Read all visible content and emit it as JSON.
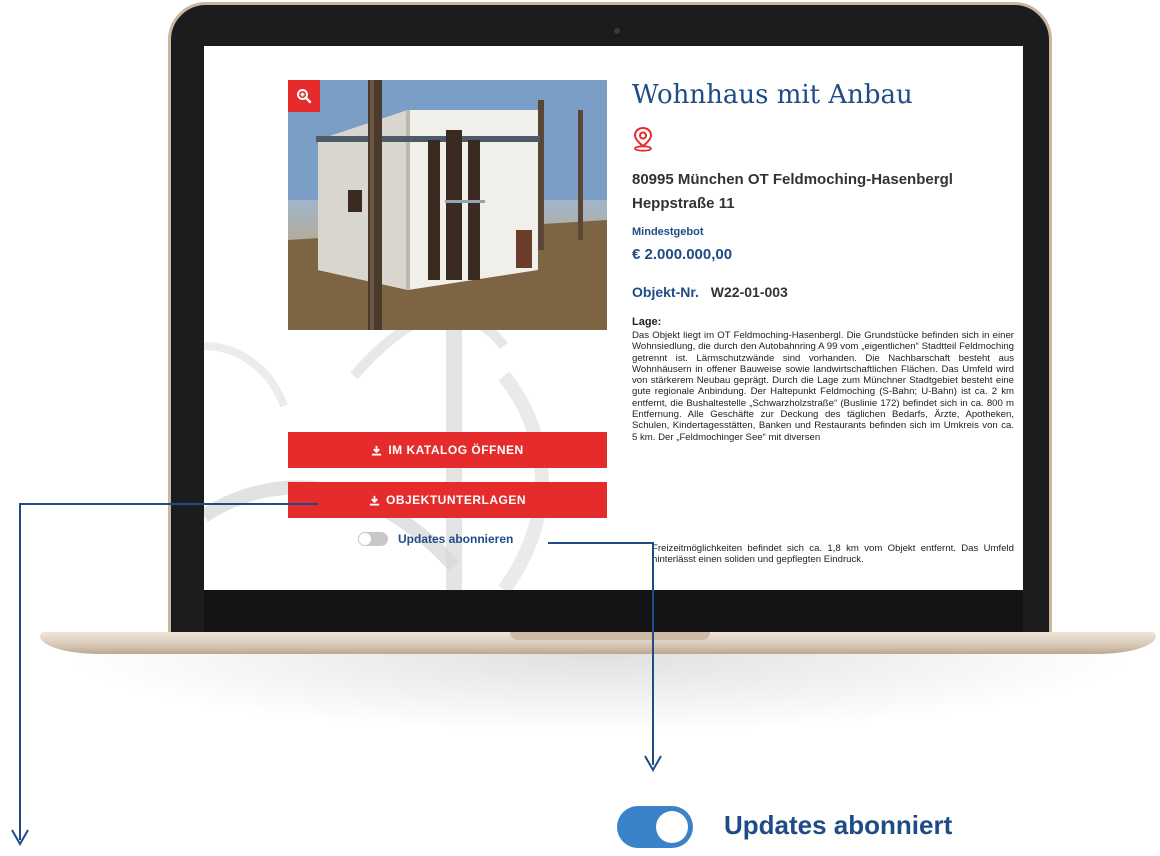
{
  "property": {
    "title": "Wohnhaus mit Anbau",
    "address_line1": "80995 München OT Feldmoching-Hasenbergl",
    "address_line2": "Heppstraße 11",
    "min_bid_label": "Mindestgebot",
    "min_bid_value": "€ 2.000.000,00",
    "object_nr_label": "Objekt-Nr.",
    "object_nr_value": "W22-01-003",
    "lage_label": "Lage:",
    "lage_text_part1": "Das Objekt liegt im OT Feldmoching-Hasenbergl. Die Grundstücke befinden sich in einer Wohnsiedlung, die durch den Autobahnring A 99 vom „eigentlichen“ Stadtteil Feldmoching getrennt ist. Lärmschutzwände sind vorhanden. Die Nachbarschaft besteht aus Wohnhäusern in offener Bauweise sowie landwirtschaftlichen Flächen. Das Umfeld wird von stärkerem Neubau geprägt. Durch die Lage zum Münchner Stadtgebiet besteht eine gute regionale Anbindung. Der Haltepunkt Feldmoching (S-Bahn; U-Bahn) ist ca. 2 km entfernt, die Bushaltestelle „Schwarzholzstraße“ (Buslinie 172) befindet sich in ca. 800 m Entfernung. Alle Geschäfte zur Deckung des täglichen Bedarfs, Ärzte, Apotheken, Schulen, Kindertagesstätten, Banken und Restaurants befinden sich im Umkreis von ca. 5 km. Der „Feldmochinger See“ mit diversen",
    "lage_text_part2": "Freizeitmöglichkeiten befindet sich ca. 1,8 km vom Objekt entfernt. Das Umfeld hinterlässt einen soliden und gepflegten Eindruck."
  },
  "buttons": {
    "catalog": "IM KATALOG ÖFFNEN",
    "documents": "OBJEKTUNTERLAGEN"
  },
  "subscription": {
    "toggle_off_label": "Updates abonnieren",
    "toggle_on_label": "Updates abonniert"
  },
  "colors": {
    "accent_red": "#e52b2b",
    "brand_blue": "#1f4b87",
    "toggle_on": "#3b83c8"
  },
  "icons": {
    "zoom": "zoom-in-icon",
    "location": "map-pin-icon",
    "download": "download-icon"
  }
}
